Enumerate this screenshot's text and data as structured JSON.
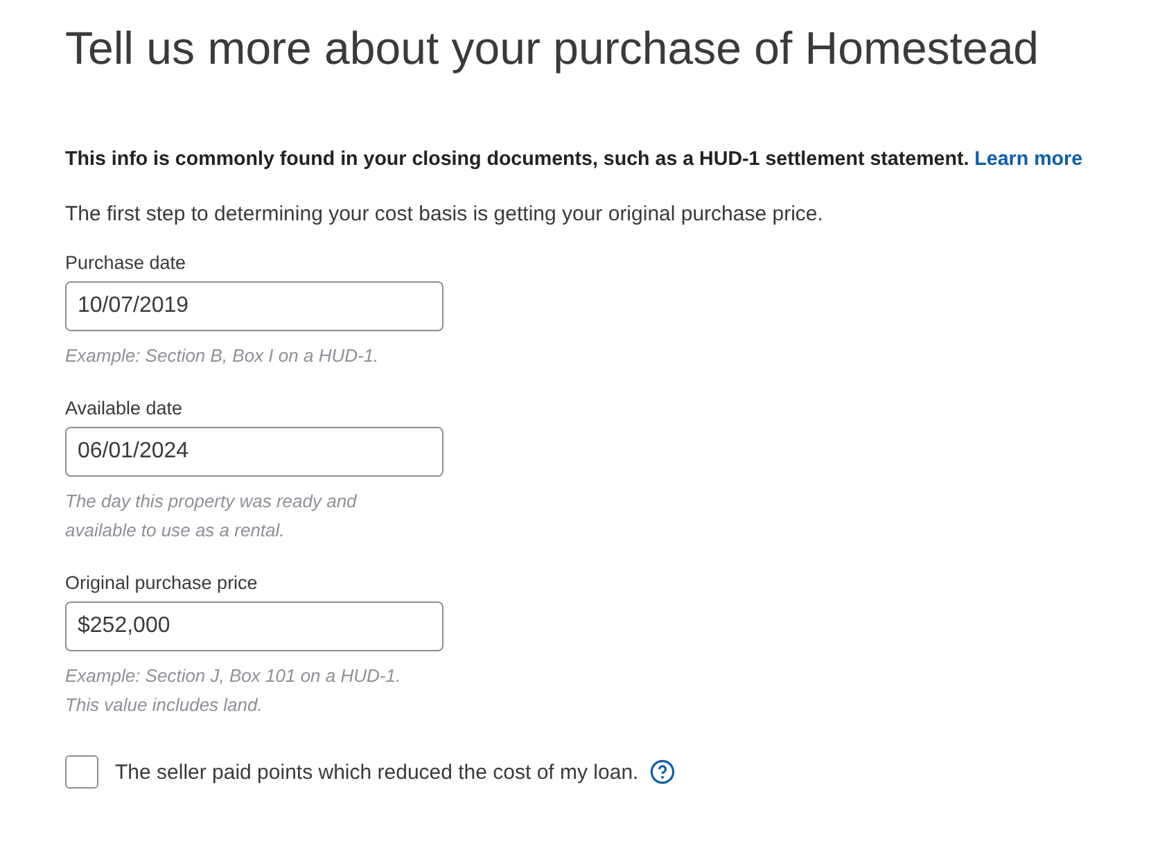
{
  "title": "Tell us more about your purchase of Homestead",
  "info": {
    "text": "This info is commonly found in your closing documents, such as a HUD-1 settlement statement.",
    "link": "Learn more"
  },
  "intro": "The first step to determining your cost basis is getting your original purchase price.",
  "fields": [
    {
      "label": "Purchase date",
      "value": "10/07/2019",
      "hint": [
        "Example: Section B, Box I on a HUD-1."
      ]
    },
    {
      "label": "Available date",
      "value": "06/01/2024",
      "hint": [
        "The day this property was ready and",
        "available to use as a rental."
      ]
    },
    {
      "label": "Original purchase price",
      "value": "$252,000",
      "hint": [
        "Example: Section J, Box 101 on a HUD-1.",
        "This value includes land."
      ]
    }
  ],
  "checkbox": {
    "label": "The seller paid points which reduced the cost of my loan.",
    "checked": false,
    "help": true
  }
}
